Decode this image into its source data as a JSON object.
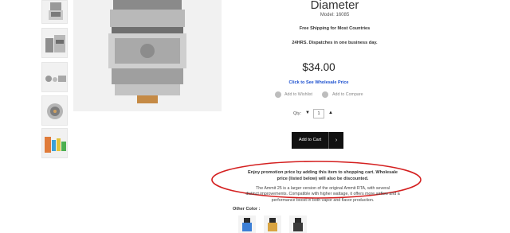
{
  "product": {
    "title": "Diameter",
    "model": "Model: 16085",
    "shipping": "Free Shipping for Most Countries",
    "dispatch": "24HRS. Dispatches in one business day.",
    "price": "$34.00",
    "wholesale_link": "Click to See Wholesale Price",
    "wishlist_label": "Add to Wishlist",
    "compare_label": "Add to Compare"
  },
  "quantity": {
    "label": "Qty:",
    "value": "1"
  },
  "cart": {
    "button_label": "Add to Cart",
    "arrow": "›"
  },
  "promo": {
    "line1": "Enjoy promotion price by adding this item to shopping cart. Wholesale",
    "line2": "price (listed below) will also be discounted."
  },
  "description": {
    "line1": "The Ammit 25 is a larger version of the original Ammit RTA, with several",
    "line2": "distinct improvements. Compatible with higher wattage, it offers more airflow and a",
    "line3": "performance boost in both vapor and flavor production."
  },
  "other_color_label": "Other Color :",
  "colors": {
    "accent": "#1b4fcf",
    "button": "#111111",
    "annotation": "#d42020"
  },
  "icons": [
    "wishlist-icon",
    "compare-icon",
    "chevron-down-icon",
    "chevron-up-icon",
    "arrow-right-icon"
  ]
}
